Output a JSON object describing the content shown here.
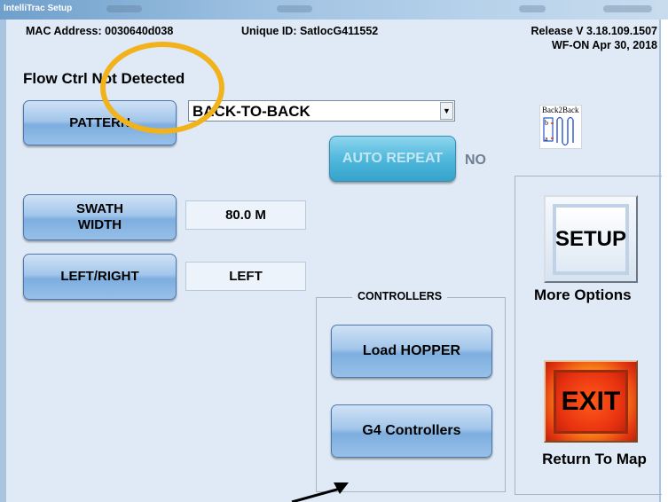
{
  "window": {
    "title": "IntelliTrac Setup"
  },
  "header": {
    "mac_address": "MAC Address: 0030640d038",
    "unique_id": "Unique ID: SatlocG411552",
    "release": "Release V 3.18.109.1507",
    "release_date": "WF-ON  Apr 30, 2018",
    "flow_ctrl": "Flow Ctrl Not Detected"
  },
  "pattern": {
    "button_label": "PATTERN",
    "selected": "BACK-TO-BACK",
    "icon_label": "Back2Back",
    "icon": "back-to-back-pattern-icon"
  },
  "auto_repeat": {
    "line1": "AUTO",
    "line2": "REPEAT",
    "status": "NO"
  },
  "swath": {
    "line1": "SWATH",
    "line2": "WIDTH",
    "value": "80.0 M"
  },
  "left_right": {
    "label": "LEFT/RIGHT",
    "value": "LEFT"
  },
  "controllers": {
    "caption": "CONTROLLERS",
    "load_hopper": "Load HOPPER",
    "g4": "G4 Controllers"
  },
  "setup": {
    "label": "SETUP",
    "caption": "More Options"
  },
  "exit": {
    "label": "EXIT",
    "caption": "Return To Map"
  },
  "colors": {
    "panel_bg": "#dfeaf6",
    "button_blue": "#7daedf",
    "auto_repeat_teal": "#50b8dc",
    "exit_red": "#e63b12",
    "highlight_circle": "#f2b21b"
  }
}
